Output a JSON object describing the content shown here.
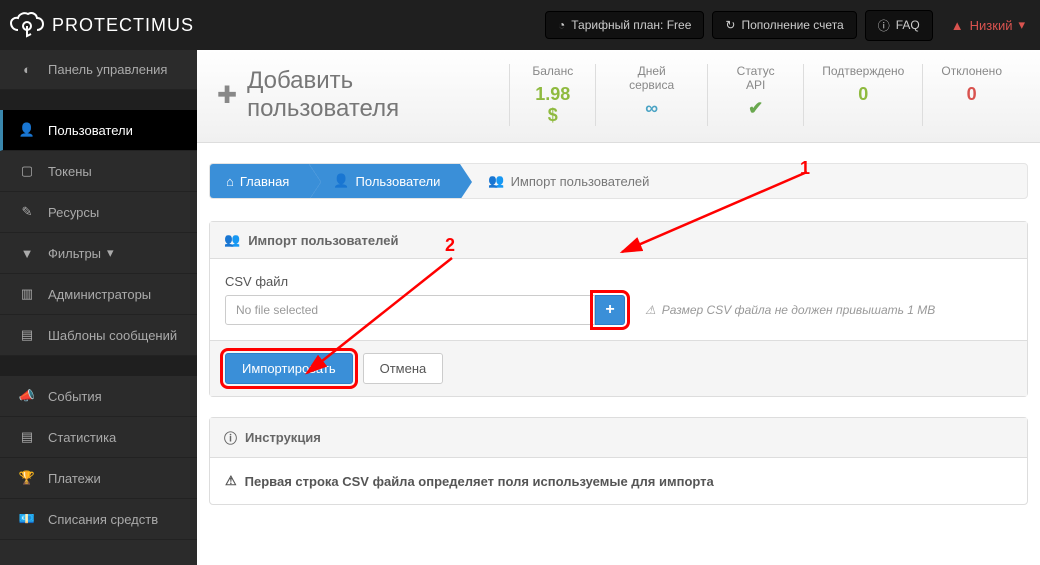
{
  "topbar": {
    "brand": "PROTECTIMUS",
    "plan_label": "Тарифный план: Free",
    "topup_label": "Пополнение счета",
    "faq_label": "FAQ",
    "user_label": "Низкий"
  },
  "sidebar": {
    "items": [
      {
        "label": "Панель управления"
      },
      {
        "label": "Пользователи"
      },
      {
        "label": "Токены"
      },
      {
        "label": "Ресурсы"
      },
      {
        "label": "Фильтры"
      },
      {
        "label": "Администраторы"
      },
      {
        "label": "Шаблоны сообщений"
      },
      {
        "label": "События"
      },
      {
        "label": "Статистика"
      },
      {
        "label": "Платежи"
      },
      {
        "label": "Списания средств"
      }
    ]
  },
  "header": {
    "title": "Добавить пользователя",
    "stats": [
      {
        "label": "Баланс",
        "value": "1.98 $",
        "cls": "val-green"
      },
      {
        "label": "Дней сервиса",
        "value": "∞",
        "cls": "val-blue"
      },
      {
        "label": "Статус API",
        "value": "✔",
        "cls": "val-check"
      },
      {
        "label": "Подтверждено",
        "value": "0",
        "cls": "val-zero"
      },
      {
        "label": "Отклонено",
        "value": "0",
        "cls": "val-red"
      }
    ]
  },
  "breadcrumb": {
    "home": "Главная",
    "users": "Пользователи",
    "import": "Импорт пользователей"
  },
  "panel1": {
    "title": "Импорт пользователей",
    "field_label": "CSV файл",
    "file_placeholder": "No file selected",
    "file_note": "Размер CSV файла не должен привышать 1 MB",
    "import_btn": "Импортировать",
    "cancel_btn": "Отмена"
  },
  "panel2": {
    "title": "Инструкция",
    "line1": "Первая строка CSV файла определяет поля используемые для импорта"
  },
  "annotations": {
    "a1": "1",
    "a2": "2"
  }
}
